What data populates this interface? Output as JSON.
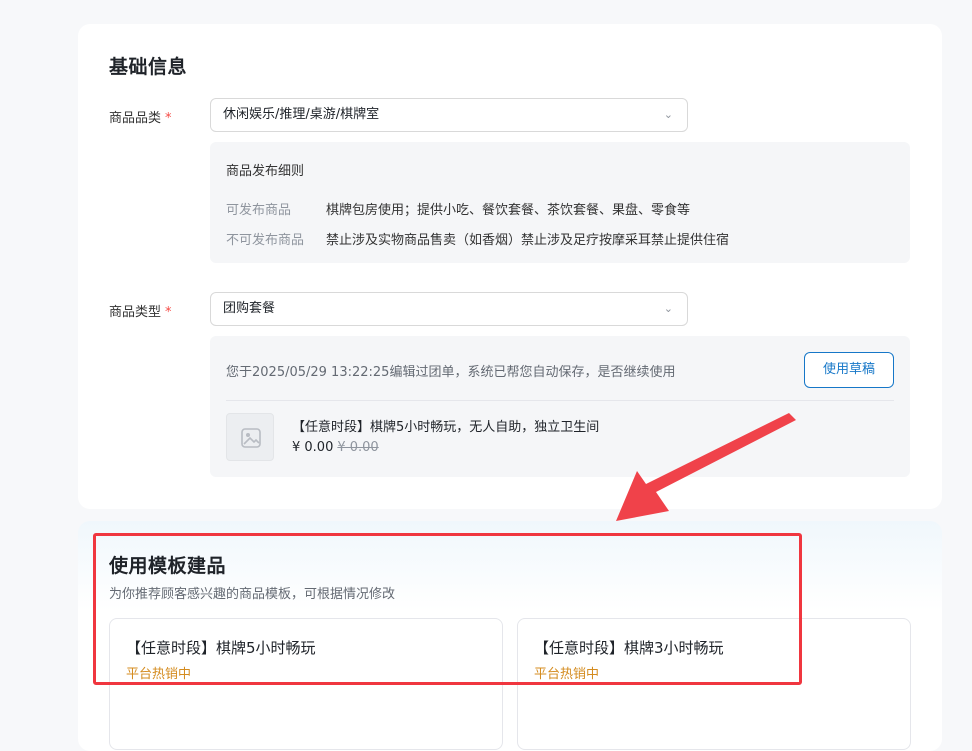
{
  "basic_info": {
    "title": "基础信息",
    "category": {
      "label": "商品品类",
      "required_mark": "*",
      "value": "休闲娱乐/推理/桌游/棋牌室"
    },
    "rules": {
      "title": "商品发布细则",
      "allowed_label": "可发布商品",
      "allowed_value": "棋牌包房使用；提供小吃、餐饮套餐、茶饮套餐、果盘、零食等",
      "forbidden_label": "不可发布商品",
      "forbidden_value": "禁止涉及实物商品售卖（如香烟）禁止涉及足疗按摩采耳禁止提供住宿"
    },
    "type": {
      "label": "商品类型",
      "required_mark": "*",
      "value": "团购套餐"
    },
    "draft": {
      "message": "您于2025/05/29 13:22:25编辑过团单，系统已帮您自动保存，是否继续使用",
      "use_button": "使用草稿",
      "product_name": "【任意时段】棋牌5小时畅玩，无人自助，独立卫生间",
      "price": "¥ 0.00",
      "original_price": "¥ 0.00"
    }
  },
  "template_section": {
    "title": "使用模板建品",
    "subtitle": "为你推荐顾客感兴趣的商品模板，可根据情况修改",
    "templates": [
      {
        "title": "【任意时段】棋牌5小时畅玩",
        "tag": "平台热销中"
      },
      {
        "title": "【任意时段】棋牌3小时畅玩",
        "tag": "平台热销中"
      }
    ]
  },
  "icons": {
    "dropdown": "chevron-down-icon",
    "thumbnail": "image-placeholder-icon"
  },
  "colors": {
    "required": "#f54a45",
    "primary": "#1677c8",
    "hot_tag": "#d48b1e",
    "annotation": "#f0363f"
  }
}
